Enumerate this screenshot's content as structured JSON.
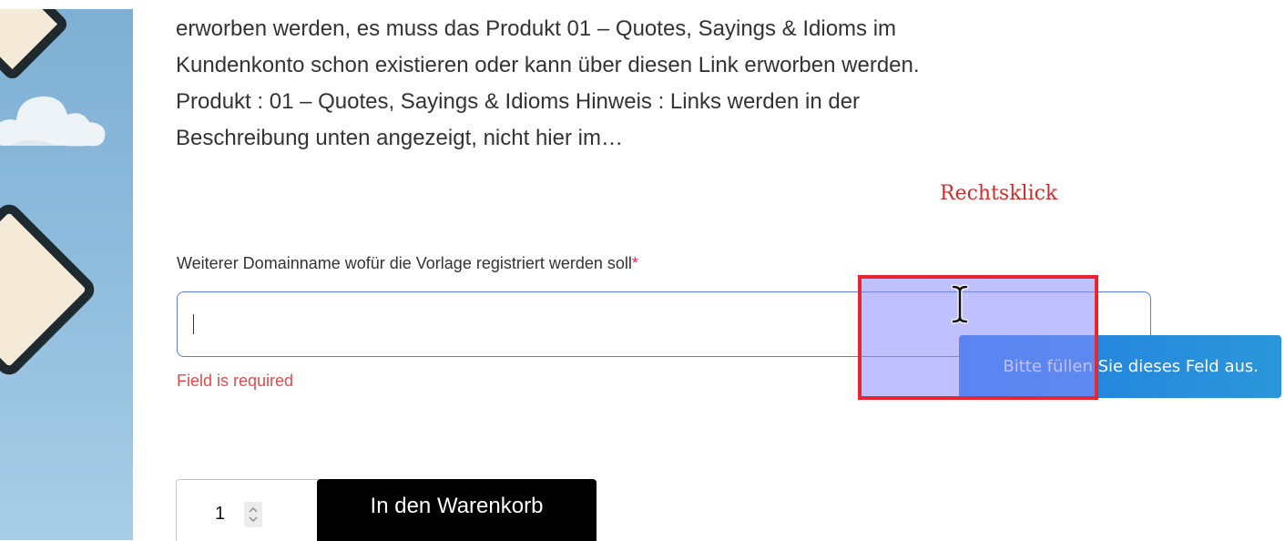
{
  "description": {
    "lines": [
      "erworben werden, es muss das Produkt 01 – Quotes, Sayings & Idioms im",
      "Kundenkonto schon existieren oder kann über diesen Link erworben werden.",
      "Produkt : 01 – Quotes, Sayings & Idioms Hinweis : Links werden in der",
      "Beschreibung unten angezeigt, nicht hier im…"
    ]
  },
  "annotation": {
    "label": "Rechtsklick",
    "color": "#d42a2a",
    "box_color": "#e8262f"
  },
  "form": {
    "field_label": "Weiterer Domainname wofür die Vorlage registriert werden soll",
    "required_marker": "*",
    "input_value": "",
    "error_text": "Field is required",
    "validation_tooltip": "Bitte füllen Sie dieses Feld aus."
  },
  "cart": {
    "quantity": "1",
    "add_button_label": "In den Warenkorb"
  },
  "colors": {
    "input_border": "#5b7be0",
    "error": "#e34a4a",
    "tooltip": "#2b97da",
    "button": "#000000"
  },
  "icons": {
    "cursor": "text-ibeam-cursor-icon",
    "spinner": "up-down-spinner-icon"
  }
}
